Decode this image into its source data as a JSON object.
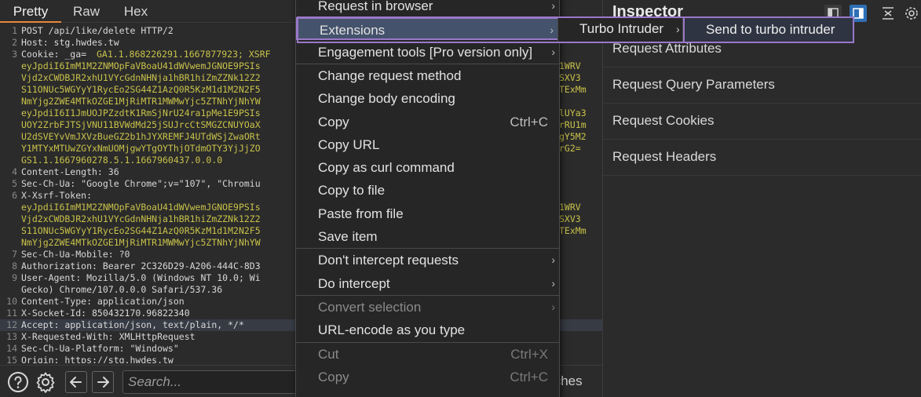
{
  "editor": {
    "tabs": [
      "Pretty",
      "Raw",
      "Hex"
    ],
    "lines": [
      {
        "n": "1",
        "text": "POST /api/like/delete HTTP/2",
        "cls": ""
      },
      {
        "n": "2",
        "text": "Host: stg.hwdes.tw",
        "cls": ""
      },
      {
        "n": "3",
        "text": "Cookie: _ga=",
        "cls": ""
      },
      {
        "n": "",
        "text": "eyJpdiI6ImM1M2ZNMOpFaVBoaU41dWVwemJGNOE9PSIs",
        "cls": "wrap"
      },
      {
        "n": "",
        "text": "Vjd2xCWDBJR2xhU1VYcGdnNHNja1hBR1hiZmZZNk12Z2",
        "cls": "wrap"
      },
      {
        "n": "",
        "text": "S11ONUc5WGYyY1RycEo2SG44Z1AzQ0R5KzM1d1M2N2F5",
        "cls": "wrap"
      },
      {
        "n": "",
        "text": "NmYjg2ZWE4MTkOZGE1MjRiMTR1MWMwYjc5ZTNhYjNhYW",
        "cls": "wrap"
      },
      {
        "n": "",
        "text": "eyJpdiI6I1JmUOJPZzdtK1RmSjNrU24ra1pMe1E9PSIs",
        "cls": "wrap"
      },
      {
        "n": "",
        "text": "UOY2ZrbFJTSjVNU11BVWdMd25jSUJrcCtSMGZCNUYOaX",
        "cls": "wrap"
      },
      {
        "n": "",
        "text": "U2dSVEYvVmJXVzBueGZ2b1hJYXREMFJ4UTdWSjZwaORt",
        "cls": "wrap"
      },
      {
        "n": "",
        "text": "Y1MTYxMTUwZGYxNmUOMjgwYTgOYThjOTdmOTY3YjJjZO",
        "cls": "wrap"
      },
      {
        "n": "",
        "text": "GS1.1.1667960278.5.1.1667960437.0.0.0",
        "cls": "wrap"
      },
      {
        "n": "4",
        "text": "Content-Length: 36",
        "cls": ""
      },
      {
        "n": "5",
        "text": "Sec-Ch-Ua: \"Google Chrome\";v=\"107\", \"Chromiu",
        "cls": ""
      },
      {
        "n": "6",
        "text": "X-Xsrf-Token:",
        "cls": ""
      },
      {
        "n": "",
        "text": "eyJpdiI6ImM1M2ZNMOpFaVBoaU41dWVwemJGNOE9PSIs",
        "cls": "wrap"
      },
      {
        "n": "",
        "text": "Vjd2xCWDBJR2xhU1VYcGdnNHNja1hBR1hiZmZZNk12Z2",
        "cls": "wrap"
      },
      {
        "n": "",
        "text": "S11ONUc5WGYyY1RycEo2SG44Z1AzQ0R5KzM1d1M2N2F5",
        "cls": "wrap"
      },
      {
        "n": "",
        "text": "NmYjg2ZWE4MTkOZGE1MjRiMTR1MWMwYjc5ZTNhYjNhYW",
        "cls": "wrap"
      },
      {
        "n": "7",
        "text": "Sec-Ch-Ua-Mobile: ?0",
        "cls": ""
      },
      {
        "n": "8",
        "text": "Authorization: Bearer 2C326D29-A206-444C-8D3",
        "cls": ""
      },
      {
        "n": "9",
        "text": "User-Agent: Mozilla/5.0 (Windows NT 10.0; Wi",
        "cls": ""
      },
      {
        "n": "",
        "text": "Gecko) Chrome/107.0.0.0 Safari/537.36",
        "cls": ""
      },
      {
        "n": "10",
        "text": "Content-Type: application/json",
        "cls": ""
      },
      {
        "n": "11",
        "text": "X-Socket-Id: 850432170.96822340",
        "cls": ""
      },
      {
        "n": "12",
        "text": "Accept: application/json, text/plain, */*",
        "cls": "hl"
      },
      {
        "n": "13",
        "text": "X-Requested-With: XMLHttpRequest",
        "cls": ""
      },
      {
        "n": "14",
        "text": "Sec-Ch-Ua-Platform: \"Windows\"",
        "cls": ""
      },
      {
        "n": "15",
        "text": "Origin: https://stg.hwdes.tw",
        "cls": ""
      }
    ],
    "cookie_value": "GA1.1.868226291.1667877923; XSRF",
    "right_tails": [
      {
        "row": 3,
        "text": "1WRV"
      },
      {
        "row": 4,
        "text": "SXV3"
      },
      {
        "row": 5,
        "text": "TExMm"
      },
      {
        "row": 7,
        "text": "lUYa3"
      },
      {
        "row": 8,
        "text": "rRU1m"
      },
      {
        "row": 9,
        "text": "gY5M2"
      },
      {
        "row": 10,
        "text": "rG2="
      },
      {
        "row": 15,
        "text": "1WRV"
      },
      {
        "row": 16,
        "text": "SXV3"
      },
      {
        "row": 17,
        "text": "TExMm"
      }
    ],
    "search_placeholder": "Search...",
    "matches_text": "tches"
  },
  "inspector": {
    "title": "Inspector",
    "rows": [
      "Request Attributes",
      "Request Query Parameters",
      "Request Cookies",
      "Request Headers"
    ]
  },
  "context_menu": {
    "items": [
      {
        "label": "Request in browser",
        "shortcut": "",
        "submenu": true,
        "disabled": false,
        "active": false,
        "sep_after": false
      },
      {
        "label": "Extensions",
        "shortcut": "",
        "submenu": true,
        "disabled": false,
        "active": true,
        "sep_after": false
      },
      {
        "label": "Engagement tools [Pro version only]",
        "shortcut": "",
        "submenu": true,
        "disabled": false,
        "active": false,
        "sep_after": true
      },
      {
        "label": "Change request method",
        "shortcut": "",
        "submenu": false,
        "disabled": false,
        "active": false,
        "sep_after": false
      },
      {
        "label": "Change body encoding",
        "shortcut": "",
        "submenu": false,
        "disabled": false,
        "active": false,
        "sep_after": false
      },
      {
        "label": "Copy",
        "shortcut": "Ctrl+C",
        "submenu": false,
        "disabled": false,
        "active": false,
        "sep_after": false
      },
      {
        "label": "Copy URL",
        "shortcut": "",
        "submenu": false,
        "disabled": false,
        "active": false,
        "sep_after": false
      },
      {
        "label": "Copy as curl command",
        "shortcut": "",
        "submenu": false,
        "disabled": false,
        "active": false,
        "sep_after": false
      },
      {
        "label": "Copy to file",
        "shortcut": "",
        "submenu": false,
        "disabled": false,
        "active": false,
        "sep_after": false
      },
      {
        "label": "Paste from file",
        "shortcut": "",
        "submenu": false,
        "disabled": false,
        "active": false,
        "sep_after": false
      },
      {
        "label": "Save item",
        "shortcut": "",
        "submenu": false,
        "disabled": false,
        "active": false,
        "sep_after": true
      },
      {
        "label": "Don't intercept requests",
        "shortcut": "",
        "submenu": true,
        "disabled": false,
        "active": false,
        "sep_after": false
      },
      {
        "label": "Do intercept",
        "shortcut": "",
        "submenu": true,
        "disabled": false,
        "active": false,
        "sep_after": true
      },
      {
        "label": "Convert selection",
        "shortcut": "",
        "submenu": true,
        "disabled": true,
        "active": false,
        "sep_after": false
      },
      {
        "label": "URL-encode as you type",
        "shortcut": "",
        "submenu": false,
        "disabled": false,
        "active": false,
        "sep_after": true
      },
      {
        "label": "Cut",
        "shortcut": "Ctrl+X",
        "submenu": false,
        "disabled": true,
        "active": false,
        "sep_after": false
      },
      {
        "label": "Copy",
        "shortcut": "Ctrl+C",
        "submenu": false,
        "disabled": true,
        "active": false,
        "sep_after": false
      }
    ],
    "submenu_level1": "Turbo Intruder",
    "submenu_level2": "Send to turbo intruder"
  },
  "colors": {
    "accent_tab": "#e8873a",
    "highlight_purple": "#9a78c8",
    "active_bg": "#44526b",
    "value_yellow": "#c8c24a"
  }
}
